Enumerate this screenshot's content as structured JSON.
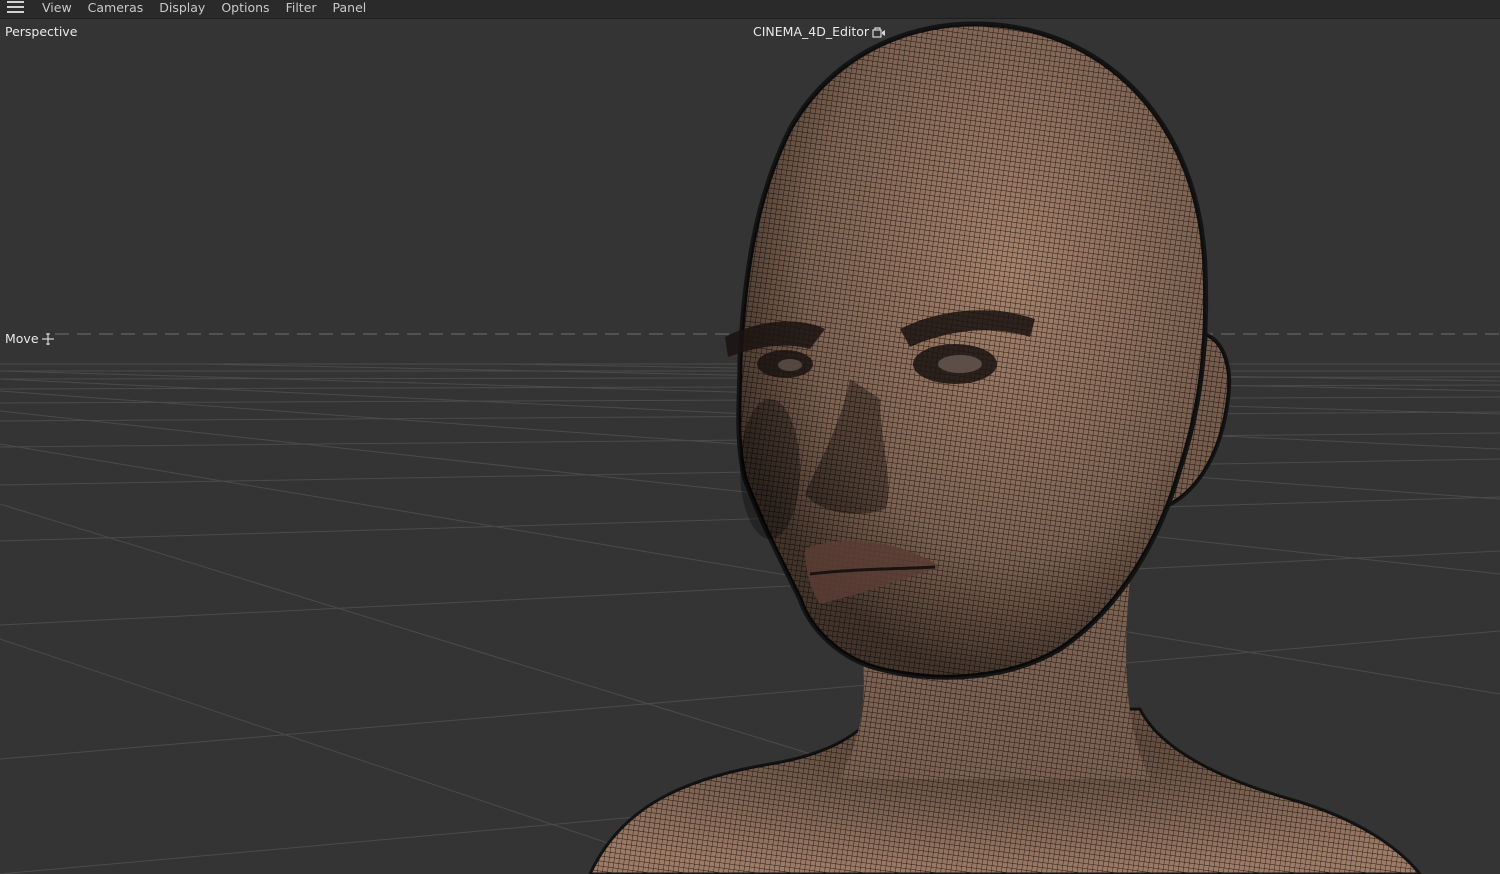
{
  "menu": {
    "icon": "hamburger-menu-icon",
    "items": [
      "View",
      "Cameras",
      "Display",
      "Options",
      "Filter",
      "Panel"
    ]
  },
  "viewport": {
    "view_name": "Perspective",
    "camera_name": "CINEMA_4D_Editor",
    "camera_icon": "camera-lock-icon",
    "tool_name": "Move",
    "tool_icon": "move-crosshair-icon",
    "model": "head-and-shoulders-mesh"
  },
  "colors": {
    "menubar_bg": "#2a2a2a",
    "viewport_bg": "#343434",
    "grid_line": "#4a4a4a",
    "horizon_dash": "#5a5a5a",
    "skin": "#9a7a66",
    "wire": "#2a1d16"
  }
}
